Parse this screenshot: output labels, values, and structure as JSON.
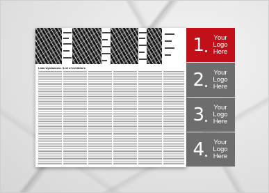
{
  "list_title": "Lista wystawców / List of exhibitors",
  "tabs": [
    {
      "number": "1",
      "logo_text": "Your Logo Here",
      "color": "#c2101a"
    },
    {
      "number": "2",
      "logo_text": "Your Logo Here",
      "color": "#6d6d6d"
    },
    {
      "number": "3",
      "logo_text": "Your Logo Here",
      "color": "#6d6d6d"
    },
    {
      "number": "4",
      "logo_text": "Your Logo Here",
      "color": "#6d6d6d"
    }
  ],
  "colors": {
    "accent": "#c2101a",
    "tab_gray": "#6d6d6d"
  }
}
